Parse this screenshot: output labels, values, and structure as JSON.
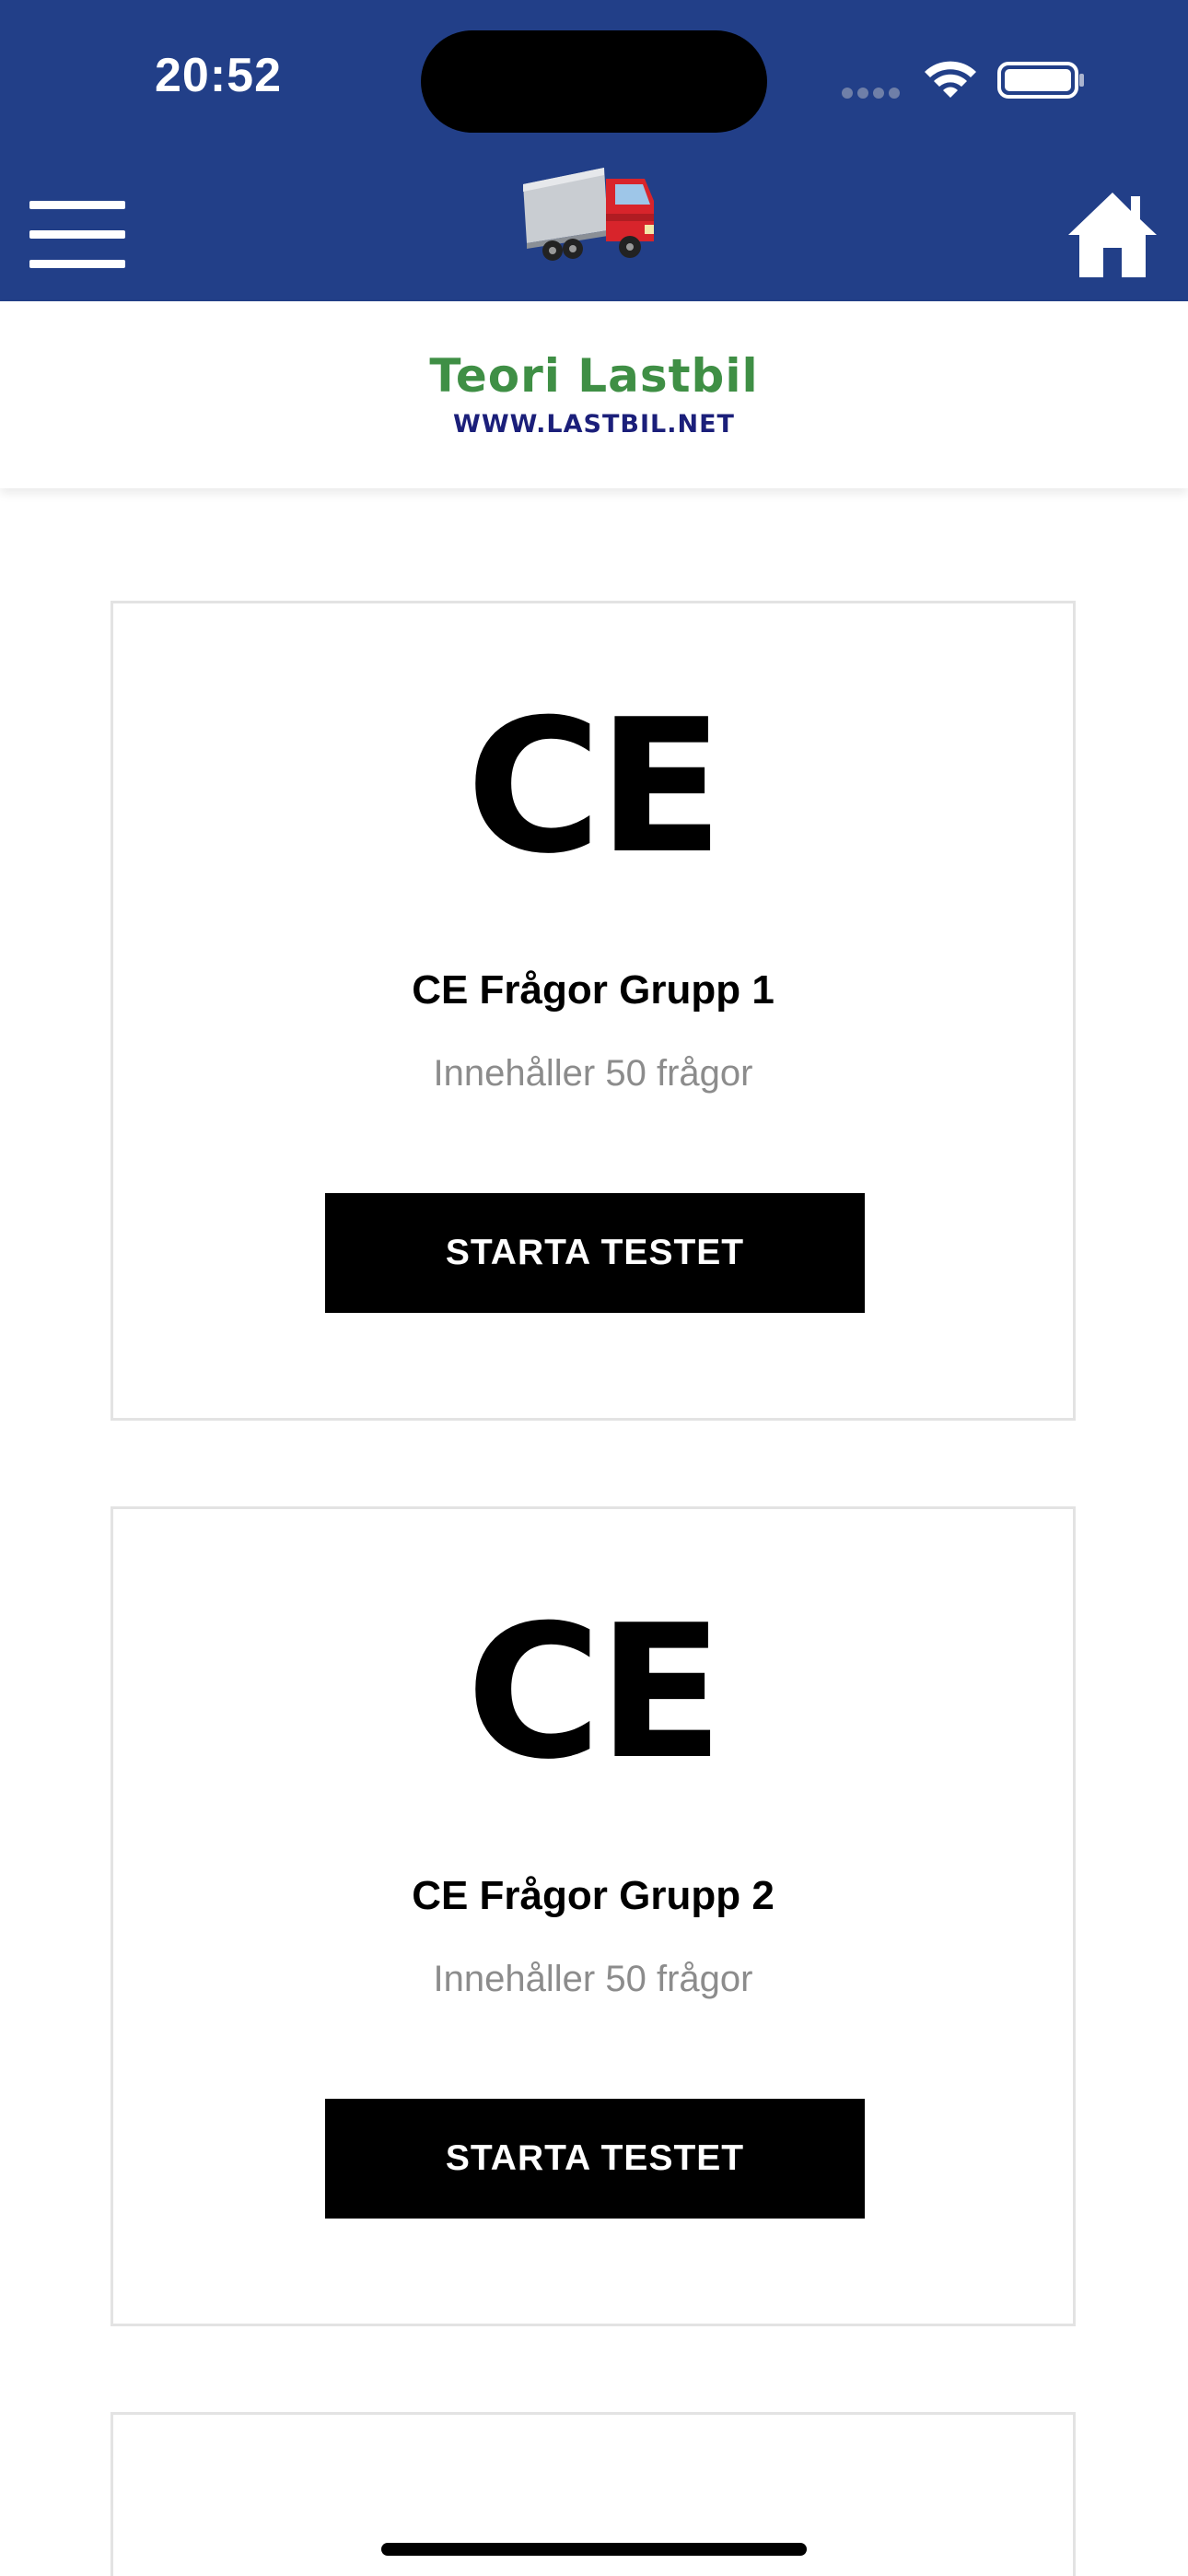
{
  "status_bar": {
    "time": "20:52"
  },
  "nav": {
    "menu_icon": "hamburger-menu-icon",
    "logo_icon": "truck-logo",
    "home_icon": "home-icon"
  },
  "brand": {
    "title": "Teori Lastbil",
    "url": "WWW.LASTBIL.NET",
    "title_color": "#3f8f45",
    "url_color": "#1b1f7a"
  },
  "colors": {
    "topbar": "#223f88",
    "button": "#000000",
    "card_border": "#e3e3e3",
    "subtitle": "#8c8c8c"
  },
  "cards": [
    {
      "badge": "CE",
      "title": "CE Frågor Grupp 1",
      "subtitle": "Innehåller 50 frågor",
      "button_label": "STARTA TESTET"
    },
    {
      "badge": "CE",
      "title": "CE Frågor Grupp 2",
      "subtitle": "Innehåller 50 frågor",
      "button_label": "STARTA TESTET"
    }
  ]
}
